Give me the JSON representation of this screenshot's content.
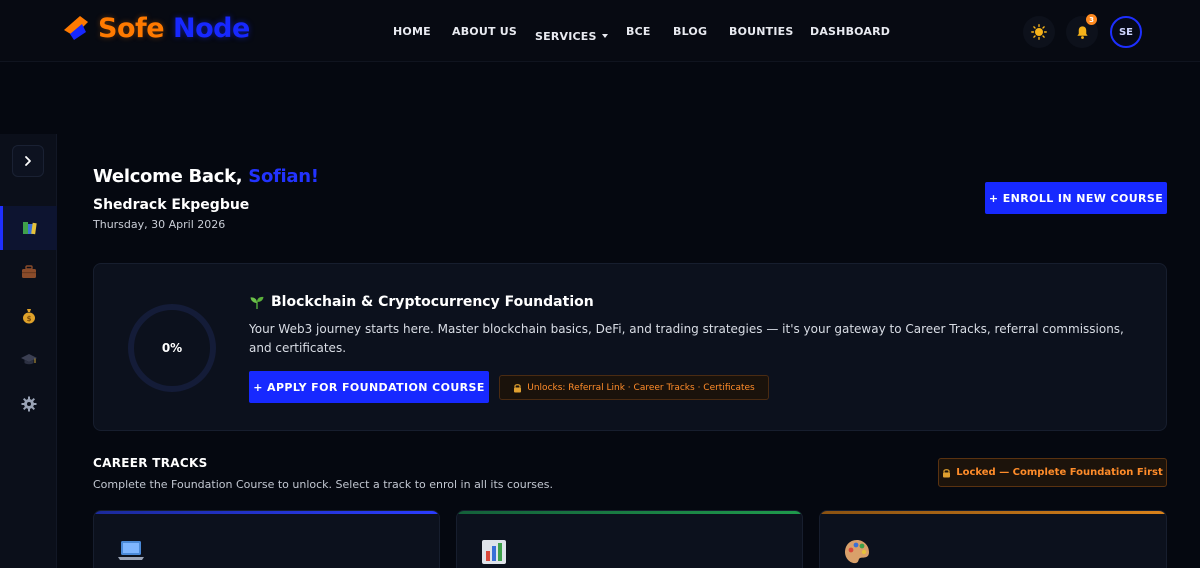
{
  "brand": {
    "part1": "Sofe",
    "part2": "Node"
  },
  "nav": [
    {
      "label": "HOME"
    },
    {
      "label": "ABOUT US"
    },
    {
      "label": "SERVICES"
    },
    {
      "label": "BCE"
    },
    {
      "label": "BLOG"
    },
    {
      "label": "BOUNTIES"
    },
    {
      "label": "DASHBOARD"
    }
  ],
  "header": {
    "notification_count": "3",
    "avatar_initials": "SE"
  },
  "sidebar": {
    "items": [
      {
        "icon": "books-icon",
        "active": true
      },
      {
        "icon": "briefcase-icon",
        "active": false
      },
      {
        "icon": "money-bag-icon",
        "active": false
      },
      {
        "icon": "graduation-cap-icon",
        "active": false
      },
      {
        "icon": "gear-icon",
        "active": false
      }
    ]
  },
  "welcome": {
    "greeting": "Welcome Back, ",
    "name": "Sofian!",
    "full_name": "Shedrack Ekpegbue",
    "date": "Thursday, 30 April 2026"
  },
  "enroll_button": "+ ENROLL IN NEW COURSE",
  "foundation": {
    "progress": "0%",
    "progress_value": 0,
    "title": "Blockchain & Cryptocurrency Foundation",
    "description": "Your Web3 journey starts here. Master blockchain basics, DeFi, and trading strategies — it's your gateway to Career Tracks, referral commissions, and certificates.",
    "apply_button": "+ APPLY FOR FOUNDATION COURSE",
    "unlocks": "Unlocks: Referral Link · Career Tracks · Certificates"
  },
  "career_tracks": {
    "title": "CAREER TRACKS",
    "subtitle": "Complete the Foundation Course to unlock. Select a track to enrol in all its courses.",
    "locked_label": "Locked — Complete Foundation First",
    "tracks": [
      {
        "icon": "laptop-icon",
        "accent": "#2a3cff"
      },
      {
        "icon": "bar-chart-icon",
        "accent": "#1f9a4c"
      },
      {
        "icon": "palette-icon",
        "accent": "#d9821a"
      }
    ]
  },
  "colors": {
    "accent_blue": "#1729ff",
    "accent_orange": "#ff7a00",
    "background": "#050810"
  }
}
